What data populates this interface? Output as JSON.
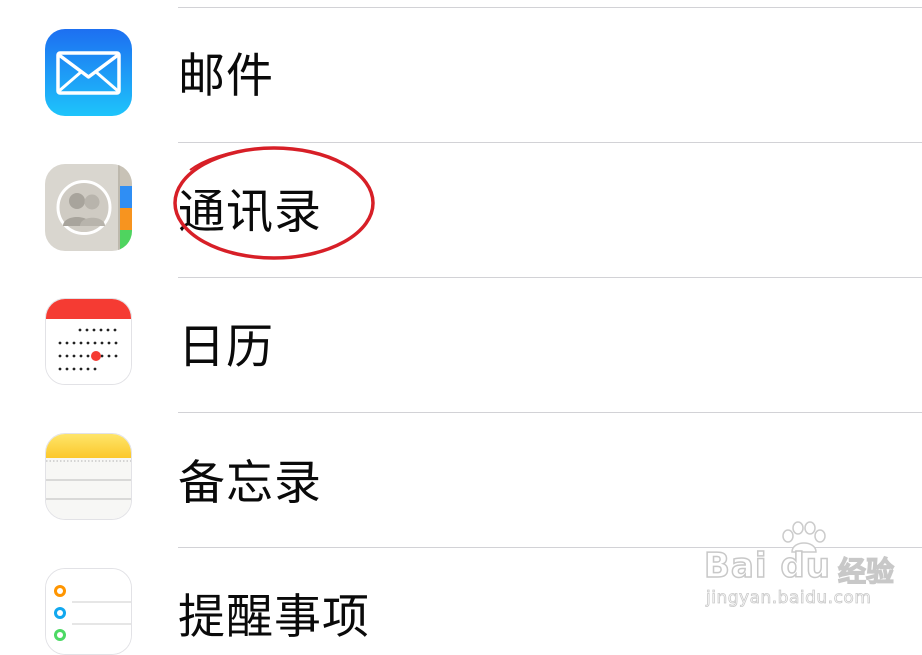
{
  "settings_list": {
    "items": [
      {
        "label": "邮件",
        "icon": "mail-icon"
      },
      {
        "label": "通讯录",
        "icon": "contacts-icon"
      },
      {
        "label": "日历",
        "icon": "calendar-icon"
      },
      {
        "label": "备忘录",
        "icon": "notes-icon"
      },
      {
        "label": "提醒事项",
        "icon": "reminders-icon"
      }
    ]
  },
  "annotation": {
    "shape": "ellipse",
    "target": "通讯录",
    "color": "#d71f27"
  },
  "watermark": {
    "brand": "Bai du",
    "subtitle": "经验",
    "url": "jingyan.baidu.com"
  },
  "colors": {
    "mail_top": "#1d6ff1",
    "mail_bottom": "#1ec4fb",
    "calendar_red": "#f53b33",
    "notes_yellow": "#fdd336",
    "reminders_orange": "#ff9500",
    "reminders_blue": "#11a8ef",
    "divider": "#d2d2d6"
  }
}
